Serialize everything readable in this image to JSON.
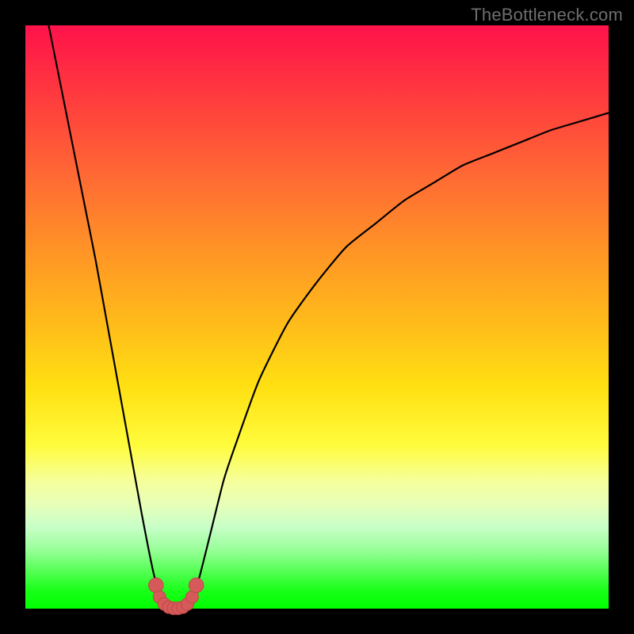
{
  "watermark": "TheBottleneck.com",
  "colors": {
    "background": "#000000",
    "curve": "#000000",
    "marker_fill": "#d65a5a",
    "marker_stroke": "#c04848"
  },
  "chart_data": {
    "type": "line",
    "title": "",
    "xlabel": "",
    "ylabel": "",
    "xlim": [
      0,
      100
    ],
    "ylim": [
      0,
      100
    ],
    "series": [
      {
        "name": "left-branch",
        "x": [
          4,
          6,
          8,
          10,
          12,
          14,
          16,
          18,
          20,
          22,
          23.5
        ],
        "values": [
          100,
          90,
          80,
          70,
          60,
          49,
          38,
          27,
          16,
          6,
          1
        ]
      },
      {
        "name": "right-branch",
        "x": [
          28.5,
          30,
          32,
          34,
          36,
          40,
          45,
          50,
          55,
          60,
          65,
          70,
          75,
          80,
          85,
          90,
          95,
          100
        ],
        "values": [
          1,
          6,
          14,
          22,
          28,
          39,
          49,
          56,
          62,
          66,
          70,
          73,
          76,
          78,
          80,
          82,
          83.5,
          85
        ]
      },
      {
        "name": "valley-floor",
        "x": [
          23.5,
          24.5,
          25.5,
          26.5,
          27.5,
          28.5
        ],
        "values": [
          1,
          0.2,
          0,
          0,
          0.2,
          1
        ]
      }
    ],
    "markers": {
      "name": "valley-markers",
      "points": [
        {
          "x": 22.4,
          "y": 4.0,
          "r": 1.4
        },
        {
          "x": 23.0,
          "y": 2.0,
          "r": 1.2
        },
        {
          "x": 23.8,
          "y": 0.8,
          "r": 1.2
        },
        {
          "x": 24.6,
          "y": 0.25,
          "r": 1.2
        },
        {
          "x": 25.4,
          "y": 0.05,
          "r": 1.2
        },
        {
          "x": 26.2,
          "y": 0.05,
          "r": 1.2
        },
        {
          "x": 27.0,
          "y": 0.25,
          "r": 1.2
        },
        {
          "x": 27.8,
          "y": 0.8,
          "r": 1.2
        },
        {
          "x": 28.6,
          "y": 2.0,
          "r": 1.2
        },
        {
          "x": 29.3,
          "y": 4.0,
          "r": 1.4
        }
      ]
    }
  }
}
